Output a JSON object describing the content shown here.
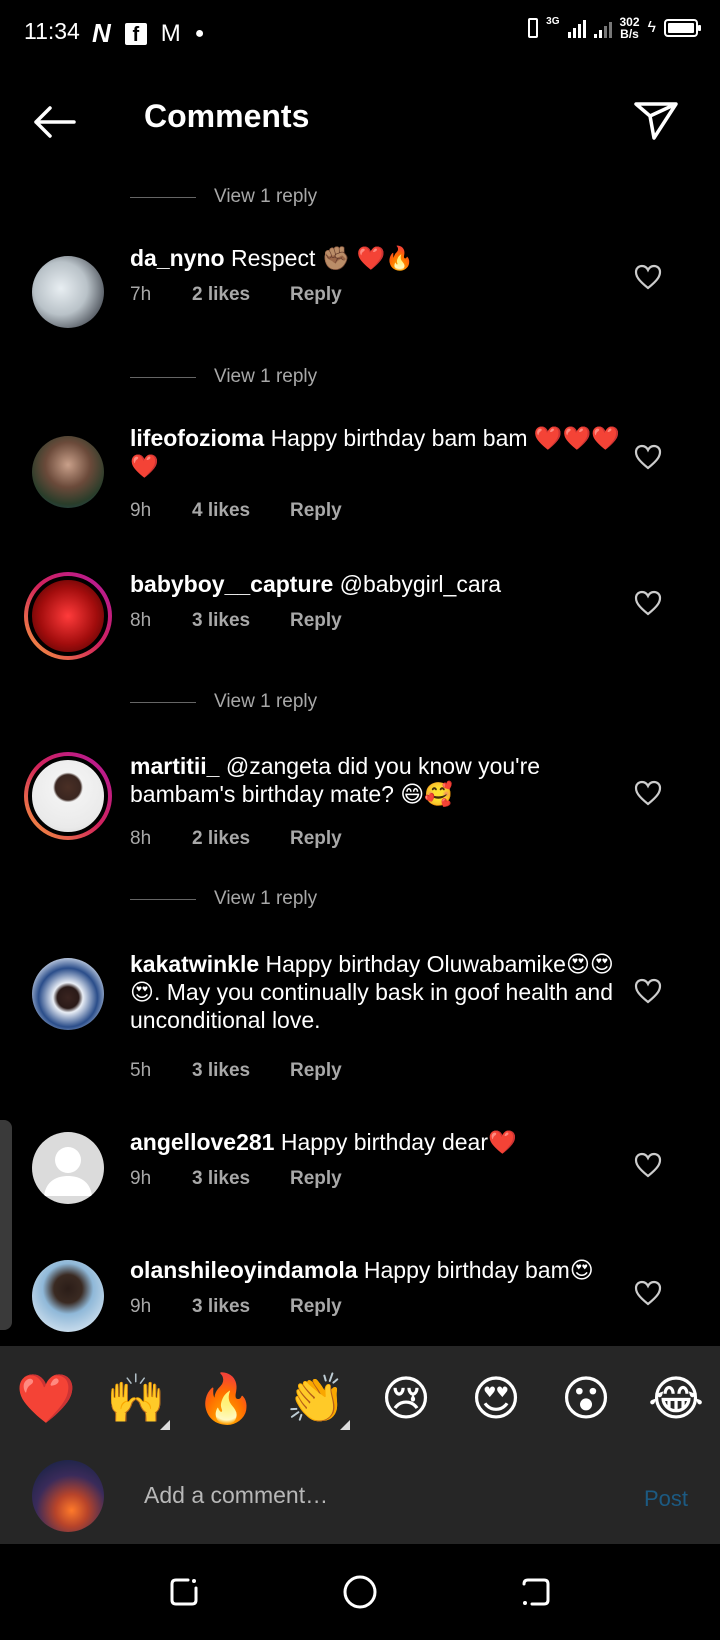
{
  "status_bar": {
    "time": "11:34",
    "network": "3G",
    "speed_value": "302",
    "speed_unit": "B/s"
  },
  "header": {
    "title": "Comments"
  },
  "view_reply_label": "View 1 reply",
  "comments": [
    {
      "user": "da_nyno",
      "text": "Respect ✊🏽 ❤️🔥",
      "time": "7h",
      "likes": "2 likes",
      "reply": "Reply"
    },
    {
      "user": "lifeofozioma",
      "text": "Happy birthday bam bam ❤️❤️❤️❤️",
      "time": "9h",
      "likes": "4 likes",
      "reply": "Reply"
    },
    {
      "user": "babyboy__capture",
      "text": "@babygirl_cara",
      "time": "8h",
      "likes": "3 likes",
      "reply": "Reply"
    },
    {
      "user": "martitii_",
      "text": "@zangeta did you know you're bambam's birthday mate? 😄🥰",
      "time": "8h",
      "likes": "2 likes",
      "reply": "Reply"
    },
    {
      "user": "kakatwinkle",
      "text": "Happy birthday  Oluwabamike😍😍😍. May you continually bask in goof health and unconditional love.",
      "time": "5h",
      "likes": "3 likes",
      "reply": "Reply"
    },
    {
      "user": "angellove281",
      "text": "Happy birthday dear❤️",
      "time": "9h",
      "likes": "3 likes",
      "reply": "Reply"
    },
    {
      "user": "olanshileoyindamola",
      "text": "Happy birthday bam😍",
      "time": "9h",
      "likes": "3 likes",
      "reply": "Reply"
    }
  ],
  "emoji_bar": [
    "❤️",
    "🙌",
    "🔥",
    "👏",
    "😢",
    "😍",
    "😮",
    "😂"
  ],
  "composer": {
    "placeholder": "Add a comment…",
    "post_label": "Post"
  },
  "colors": {
    "background": "#000000",
    "secondary_text": "#a8a8a8",
    "bar_background": "#262626",
    "post_disabled": "#1c5a82"
  }
}
